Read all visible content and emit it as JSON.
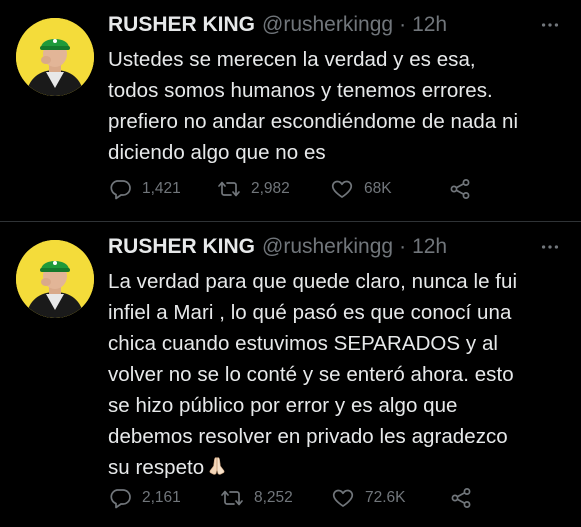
{
  "tweets": [
    {
      "name": "RUSHER KING",
      "handle": "@rusherkingg",
      "separator": "·",
      "time": "12h",
      "lines": [
        "Ustedes se merecen la verdad y es esa,",
        "todos somos humanos y tenemos errores.",
        "prefiero no andar escondiéndome de nada ni",
        "diciendo algo que no es"
      ],
      "replies": "1,421",
      "retweets": "2,982",
      "likes": "68K"
    },
    {
      "name": "RUSHER KING",
      "handle": "@rusherkingg",
      "separator": "·",
      "time": "12h",
      "lines": [
        "La verdad para que quede claro, nunca le fui",
        "infiel a Mari , lo qué pasó es que conocí una",
        "chica cuando estuvimos SEPARADOS y al",
        "volver no se lo conté y se enteró ahora. esto",
        "se hizo público por error y es algo que",
        "debemos resolver en privado les agradezco",
        "su respeto"
      ],
      "emoji": "folded-hands-icon",
      "replies": "2,161",
      "retweets": "8,252",
      "likes": "72.6K"
    }
  ],
  "colors": {
    "background": "#000000",
    "text": "#e7e9ea",
    "secondary": "#71767b",
    "divider": "#2f3336",
    "avatar_bg": "#f4dc3a",
    "cap": "#1f9a3a"
  }
}
